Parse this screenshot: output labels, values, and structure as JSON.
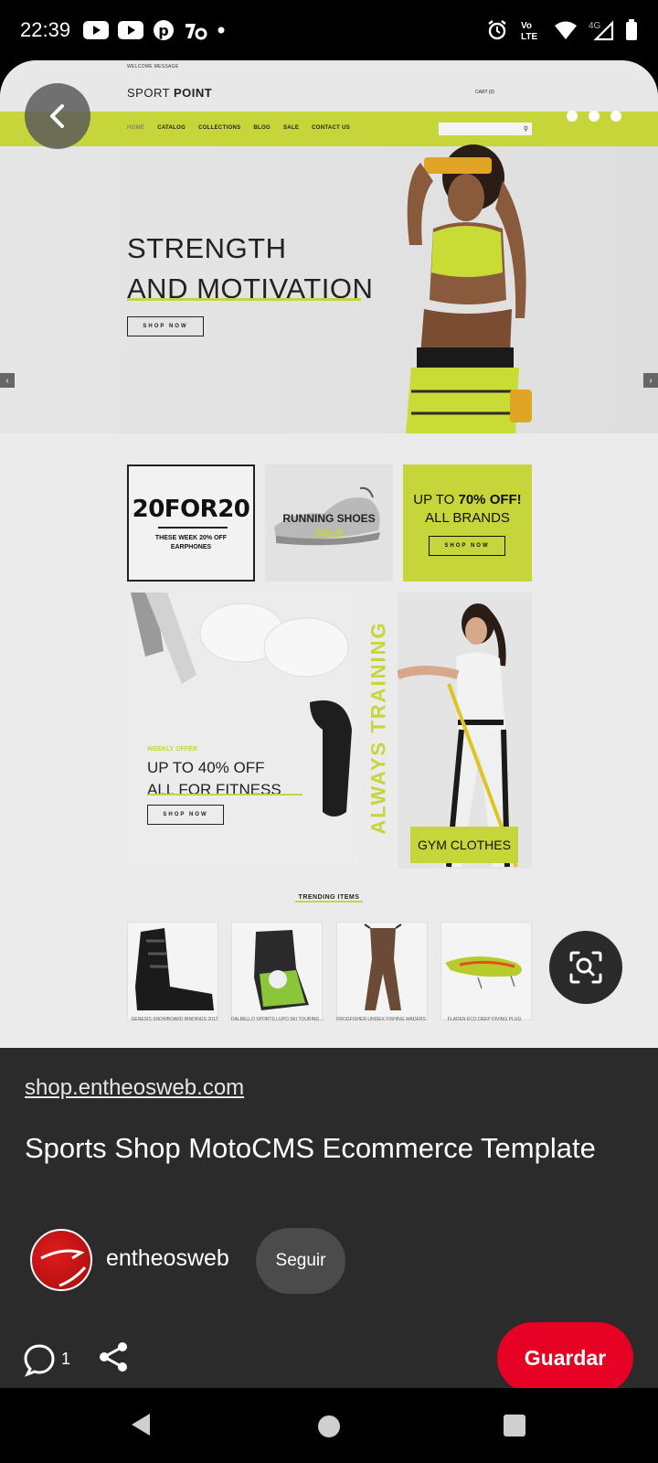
{
  "status_bar": {
    "time": "22:39",
    "left_icons": [
      "youtube-icon",
      "youtube-icon",
      "pinterest-icon",
      "bolt-app-icon",
      "dot-icon"
    ],
    "right_icons": [
      "alarm-icon",
      "volte-icon",
      "wifi-icon",
      "signal-4g-icon",
      "battery-icon"
    ],
    "volte_label": "Vo LTE",
    "network_label": "4G"
  },
  "pin_image": {
    "welcome": "WELCOME MESSAGE",
    "logo_light": "SPORT ",
    "logo_bold": "POINT",
    "cart": "CART (0)",
    "nav": [
      "HOME",
      "CATALOG",
      "COLLECTIONS",
      "BLOG",
      "SALE",
      "CONTACT US"
    ],
    "hero_line1": "STRENGTH",
    "hero_line2": "AND MOTIVATION",
    "hero_btn": "SHOP NOW",
    "promo1_title": "20FOR20",
    "promo1_sub_a": "THESE WEEK 20% OFF",
    "promo1_sub_b": "EARPHONES",
    "promo2_label": "RUNNING SHOES",
    "promo2_sale": "SALE",
    "promo3_prefix": "UP TO ",
    "promo3_bold": "70% OFF!",
    "promo3_line2": "ALL BRANDS",
    "promo3_btn": "SHOP NOW",
    "fitness_weekly": "WEEKLY OFFER",
    "fitness_line1": "UP TO 40% OFF",
    "fitness_line2": "ALL FOR FITNESS",
    "fitness_btn": "SHOP NOW",
    "always_training": "ALWAYS TRAINING",
    "gym_label": "GYM CLOTHES",
    "trending": "TRENDING ITEMS",
    "products": [
      "GENESIS SNOWBOARD BINDINGS 2017",
      "DALBELLO SPORTS LUPO SKI TOURING ...",
      "FROGFISHER UNISEX FISHING WADERS",
      "FLADEN ECO DEEP DIVING PLUG"
    ],
    "accent_color": "#c6d63a"
  },
  "info": {
    "source": "shop.entheosweb.com",
    "title": "Sports Shop MotoCMS Ecommerce Template",
    "username": "entheosweb",
    "follow_label": "Seguir",
    "comment_count": "1",
    "save_label": "Guardar",
    "save_color": "#e60023"
  }
}
